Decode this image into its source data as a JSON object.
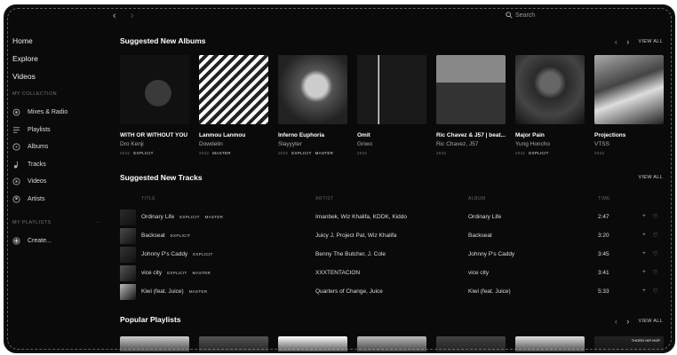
{
  "topbar": {
    "back_label": "‹",
    "forward_label": "›",
    "search_placeholder": "Search"
  },
  "sidebar": {
    "links": [
      "Home",
      "Explore",
      "Videos"
    ],
    "collection_heading": "MY COLLECTION",
    "collection_items": [
      {
        "label": "Mixes & Radio",
        "icon": "radio-icon"
      },
      {
        "label": "Playlists",
        "icon": "playlists-icon"
      },
      {
        "label": "Albums",
        "icon": "album-icon"
      },
      {
        "label": "Tracks",
        "icon": "track-icon"
      },
      {
        "label": "Videos",
        "icon": "video-icon"
      },
      {
        "label": "Artists",
        "icon": "artist-icon"
      }
    ],
    "playlists_heading": "MY PLAYLISTS",
    "playlists_more": "···",
    "create_label": "Create..."
  },
  "albums_section": {
    "title": "Suggested New Albums",
    "prev": "‹",
    "next": "›",
    "view_all": "VIEW ALL",
    "items": [
      {
        "title": "WITH OR WITHOUT YOU",
        "artist": "Dro Kenji",
        "year": "2022",
        "badges": [
          "EXPLICIT"
        ]
      },
      {
        "title": "Lanmou Lanmou",
        "artist": "Dowdelin",
        "year": "2022",
        "badges": [
          "MASTER"
        ]
      },
      {
        "title": "Inferno Euphoria",
        "artist": "Slayyyter",
        "year": "2022",
        "badges": [
          "EXPLICIT",
          "MASTER"
        ]
      },
      {
        "title": "Omit",
        "artist": "Griwo",
        "year": "2022",
        "badges": []
      },
      {
        "title": "Ric Chavez & J57 | beat...",
        "artist": "Ric Chavez, J57",
        "year": "2022",
        "badges": []
      },
      {
        "title": "Major Pain",
        "artist": "Yung Honcho",
        "year": "2022",
        "badges": [
          "EXPLICIT"
        ]
      },
      {
        "title": "Projections",
        "artist": "VTSS",
        "year": "2022",
        "badges": []
      }
    ]
  },
  "tracks_section": {
    "title": "Suggested New Tracks",
    "view_all": "VIEW ALL",
    "columns": {
      "title": "TITLE",
      "artist": "ARTIST",
      "album": "ALBUM",
      "time": "TIME"
    },
    "rows": [
      {
        "title": "Ordinary Life",
        "badges": [
          "EXPLICIT",
          "MASTER"
        ],
        "artist": "Imanbek, Wiz Khalifa, KDDK, Kiddo",
        "album": "Ordinary Life",
        "time": "2:47"
      },
      {
        "title": "Backseat",
        "badges": [
          "EXPLICIT"
        ],
        "artist": "Juicy J, Project Pat, Wiz Khalifa",
        "album": "Backseat",
        "time": "3:20"
      },
      {
        "title": "Johnny P's Caddy",
        "badges": [
          "EXPLICIT"
        ],
        "artist": "Benny The Butcher, J. Cole",
        "album": "Johnny P's Caddy",
        "time": "3:45"
      },
      {
        "title": "vice city",
        "badges": [
          "EXPLICIT",
          "MASTER"
        ],
        "artist": "XXXTENTACION",
        "album": "vice city",
        "time": "3:41"
      },
      {
        "title": "Kiwi (feat. Juice)",
        "badges": [
          "MASTER"
        ],
        "artist": "Quarters of Change, Juice",
        "album": "Kiwi (feat. Juice)",
        "time": "5:33"
      }
    ],
    "add_label": "+",
    "favorite_label": "♡"
  },
  "playlists_section": {
    "title": "Popular Playlists",
    "prev": "‹",
    "next": "›",
    "view_all": "VIEW ALL",
    "tags": [
      "",
      "",
      "",
      "",
      "",
      "",
      "THORO HIP-HOP"
    ]
  }
}
